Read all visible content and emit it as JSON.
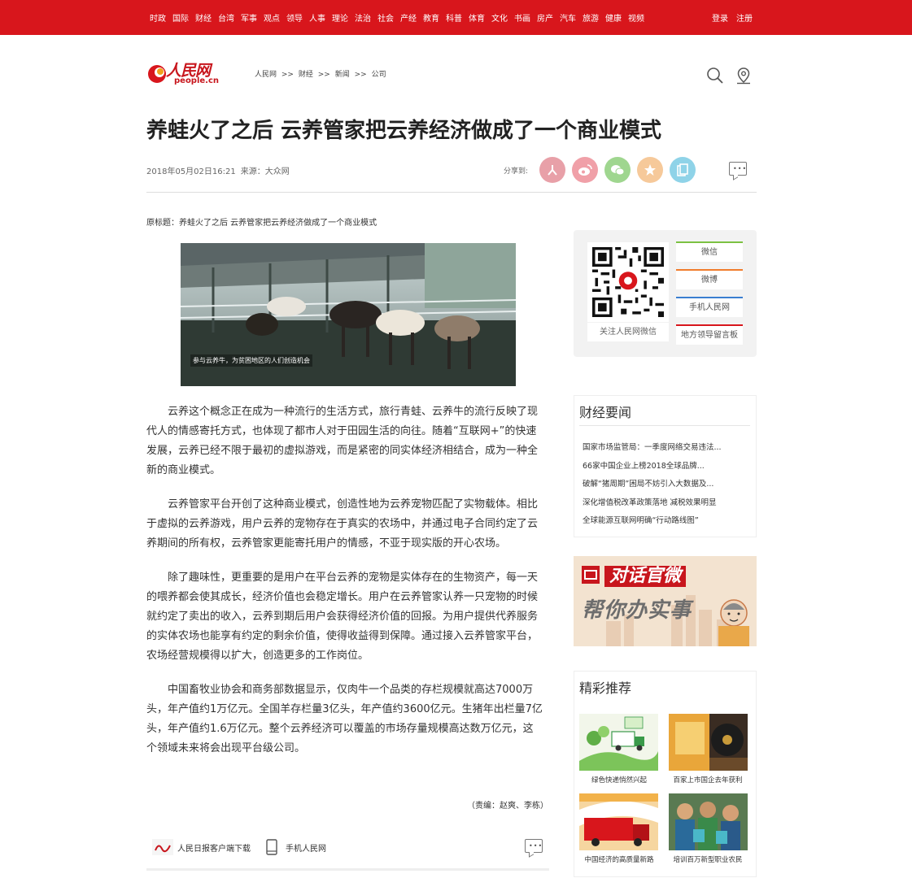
{
  "topnav": {
    "items": [
      "时政",
      "国际",
      "财经",
      "台湾",
      "军事",
      "观点",
      "领导",
      "人事",
      "理论",
      "法治",
      "社会",
      "产经",
      "教育",
      "科普",
      "体育",
      "文化",
      "书画",
      "房产",
      "汽车",
      "旅游",
      "健康",
      "视频"
    ],
    "login": "登录",
    "register": "注册"
  },
  "header": {
    "logo_main": "人民网",
    "logo_sub": "people.cn",
    "breadcrumb": [
      "人民网",
      ">>",
      "财经",
      ">>",
      "新闻",
      ">>",
      "公司"
    ]
  },
  "article": {
    "title": "养蛙火了之后 云养管家把云养经济做成了一个商业模式",
    "datetime": "2018年05月02日16:21",
    "source_label": "来源：",
    "source": "大众网",
    "share_label": "分享到:",
    "original_title": "原标题：养蛙火了之后 云养管家把云养经济做成了一个商业模式",
    "photo_caption": "参与云养牛，为贫困地区的人们创造机会",
    "paragraphs": [
      "云养这个概念正在成为一种流行的生活方式，旅行青蛙、云养牛的流行反映了现代人的情感寄托方式，也体现了都市人对于田园生活的向往。随着“互联网+”的快速发展，云养已经不限于最初的虚拟游戏，而是紧密的同实体经济相结合，成为一种全新的商业模式。",
      "云养管家平台开创了这种商业模式，创造性地为云养宠物匹配了实物载体。相比于虚拟的云养游戏，用户云养的宠物存在于真实的农场中，并通过电子合同约定了云养期间的所有权，云养管家更能寄托用户的情感，不亚于现实版的开心农场。",
      "除了趣味性，更重要的是用户在平台云养的宠物是实体存在的生物资产，每一天的喂养都会使其成长，经济价值也会稳定增长。用户在云养管家认养一只宠物的时候就约定了卖出的收入，云养到期后用户会获得经济价值的回报。为用户提供代养服务的实体农场也能享有约定的剩余价值，使得收益得到保障。通过接入云养管家平台，农场经营规模得以扩大，创造更多的工作岗位。",
      "中国畜牧业协会和商务部数据显示，仅肉牛一个品类的存栏规模就高达7000万头，年产值约1万亿元。全国羊存栏量3亿头，年产值约3600亿元。生猪年出栏量7亿头，年产值约1.6万亿元。整个云养经济可以覆盖的市场存量规模高达数万亿元，这个领域未来将会出现平台级公司。"
    ],
    "editor": "（责编：赵爽、李栋）",
    "footer_app": "人民日报客户端下载",
    "footer_mobile": "手机人民网"
  },
  "sidebar": {
    "qr_label": "关注人民网微信",
    "buttons": [
      "微信",
      "微博",
      "手机人民网",
      "地方领导留言板"
    ],
    "button_colors": [
      "#7bc142",
      "#f07c2c",
      "#3a7fd0",
      "#d8161c"
    ],
    "news_title": "财经要闻",
    "news": [
      "国家市场监管局：一季度网络交易违法...",
      "66家中国企业上榜2018全球品牌...",
      "破解“猪周期”困局不妨引入大数据及...",
      "深化增值税改革政策落地 减税效果明显",
      "全球能源互联网明确“行动路线图”"
    ],
    "banner_line1": "对话官微",
    "banner_line2": "帮你办实事",
    "rec_title": "精彩推荐",
    "recommendations": [
      "绿色快递悄然兴起",
      "百家上市国企去年获利",
      "中国经济的高质量新路",
      "培训百万新型职业农民"
    ]
  },
  "colors": {
    "brand_red": "#d8161c",
    "share": [
      "#e8a0a8",
      "#f0a0a8",
      "#9fd68f",
      "#f6c99a",
      "#8fd3e8"
    ]
  },
  "icons": [
    "search-icon",
    "location-icon",
    "comment-icon",
    "phone-icon"
  ]
}
